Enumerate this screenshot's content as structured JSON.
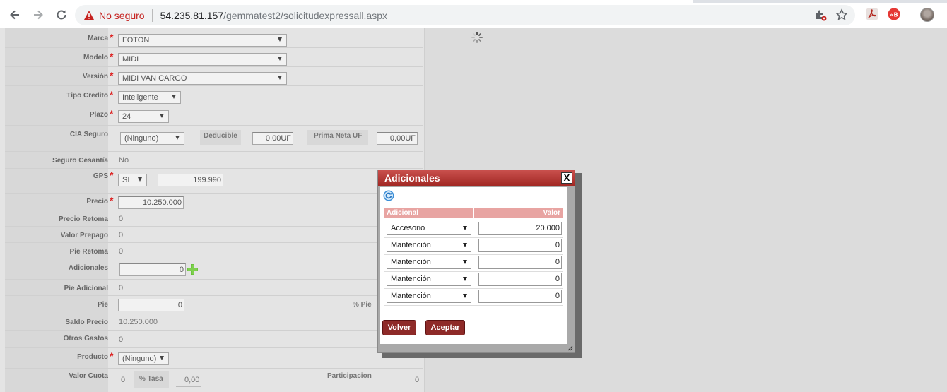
{
  "browser": {
    "security_label": "No seguro",
    "url_host": "54.235.81.157",
    "url_path": "/gemmatest2/solicitudexpressall.aspx"
  },
  "form": {
    "marca": {
      "label": "Marca",
      "value": "FOTON"
    },
    "modelo": {
      "label": "Modelo",
      "value": "MIDI"
    },
    "version": {
      "label": "Versión",
      "value": "MIDI VAN CARGO"
    },
    "tipo_credito": {
      "label": "Tipo Credito",
      "value": "Inteligente"
    },
    "plazo": {
      "label": "Plazo",
      "value": "24"
    },
    "cia_seguro": {
      "label": "CIA Seguro",
      "value": "(Ninguno)",
      "deducible_label": "Deducible",
      "deducible_value": "0,00UF",
      "prima_label": "Prima Neta UF",
      "prima_value": "0,00UF"
    },
    "seguro_cesantia": {
      "label": "Seguro Cesantía",
      "value": "No"
    },
    "gps": {
      "label": "GPS",
      "value": "SI",
      "amount": "199.990"
    },
    "precio": {
      "label": "Precio",
      "value": "10.250.000"
    },
    "precio_retoma": {
      "label": "Precio Retoma",
      "value": "0"
    },
    "valor_prepago": {
      "label": "Valor Prepago",
      "value": "0"
    },
    "pie_retoma": {
      "label": "Pie Retoma",
      "value": "0"
    },
    "adicionales": {
      "label": "Adicionales",
      "value": "0"
    },
    "pie_adicional": {
      "label": "Pie Adicional",
      "value": "0"
    },
    "pie": {
      "label": "Pie",
      "value": "0",
      "percent_label": "% Pie"
    },
    "saldo_precio": {
      "label": "Saldo Precio",
      "value": "10.250.000"
    },
    "otros_gastos": {
      "label": "Otros Gastos",
      "value": "0"
    },
    "producto": {
      "label": "Producto",
      "value": "(Ninguno)"
    },
    "valor_cuota": {
      "label": "Valor Cuota",
      "value": "0",
      "tasa_label": "% Tasa",
      "tasa_value": "0,00",
      "participacion_label": "Participacion",
      "participacion_value": "0"
    }
  },
  "modal": {
    "title": "Adicionales",
    "close_label": "X",
    "col_adicional": "Adicional",
    "col_valor": "Valor",
    "rows": [
      {
        "type": "Accesorio",
        "value": "20.000"
      },
      {
        "type": "Mantención",
        "value": "0"
      },
      {
        "type": "Mantención",
        "value": "0"
      },
      {
        "type": "Mantención",
        "value": "0"
      },
      {
        "type": "Mantención",
        "value": "0"
      }
    ],
    "btn_back": "Volver",
    "btn_accept": "Aceptar"
  },
  "colors": {
    "modal_header": "#a22824",
    "button": "#8e2a28",
    "required": "#dd2222",
    "table_header": "#e8a4a2"
  }
}
